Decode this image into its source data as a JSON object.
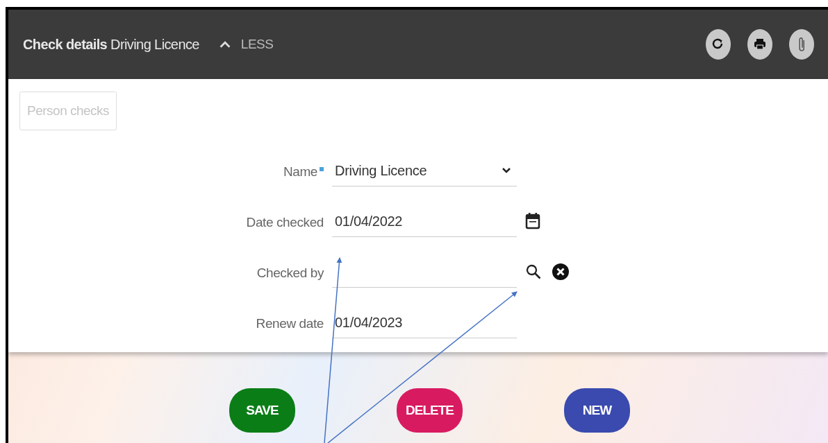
{
  "header": {
    "title": "Check details",
    "subtitle": "Driving Licence",
    "toggle_label": "LESS",
    "expanded": true
  },
  "header_actions": [
    {
      "kind": "refresh"
    },
    {
      "kind": "print"
    },
    {
      "kind": "attach"
    }
  ],
  "person_checks_button": {
    "label": "Person checks",
    "disabled": true
  },
  "form": {
    "fields": [
      {
        "label": "Name",
        "required": true,
        "kind": "select",
        "value": "Driving Licence"
      },
      {
        "label": "Date checked",
        "required": false,
        "kind": "date",
        "value": "01/04/2022"
      },
      {
        "label": "Checked by",
        "required": false,
        "kind": "lookup"
      },
      {
        "label": "Renew date",
        "required": false,
        "kind": "text",
        "value": "01/04/2023"
      }
    ]
  },
  "buttons": [
    {
      "label": "SAVE",
      "color": "#0b7d17"
    },
    {
      "label": "DELETE",
      "color": "#d81b60"
    },
    {
      "label": "NEW",
      "color": "#3a4aae"
    }
  ]
}
